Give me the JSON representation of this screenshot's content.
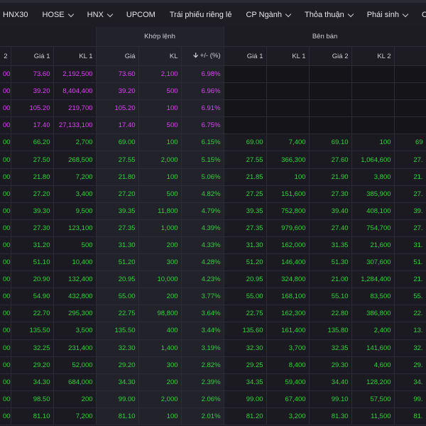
{
  "nav": {
    "tabs": [
      {
        "label": "HNX30",
        "dropdown": false
      },
      {
        "label": "HOSE",
        "dropdown": true
      },
      {
        "label": "HNX",
        "dropdown": true
      },
      {
        "label": "UPCOM",
        "dropdown": false
      },
      {
        "label": "Trái phiếu riêng lẻ",
        "dropdown": false
      },
      {
        "label": "CP Ngành",
        "dropdown": true
      },
      {
        "label": "Thỏa thuận",
        "dropdown": true
      },
      {
        "label": "Phái sinh",
        "dropdown": true
      },
      {
        "label": "Chứng quy",
        "dropdown": false
      }
    ]
  },
  "table": {
    "group_khop": "Khớp lệnh",
    "group_ban": "Bên bán",
    "headers": [
      "2",
      "Giá 1",
      "KL 1",
      "Giá",
      "KL",
      "+/- (%)",
      "Giá 1",
      "KL 1",
      "Giá 2",
      "KL 2",
      ""
    ],
    "change_arrow": "🡫",
    "colors": {
      "ceiling": "#e040fb",
      "up": "#2fd43a"
    },
    "rows": [
      {
        "s": "ce",
        "c": [
          "00",
          "73.60",
          "2,192,500",
          "73.60",
          "2,100",
          "6.98%",
          "",
          "",
          "",
          "",
          ""
        ]
      },
      {
        "s": "ce",
        "c": [
          "00",
          "39.20",
          "8,404,400",
          "39.20",
          "500",
          "6.96%",
          "",
          "",
          "",
          "",
          ""
        ]
      },
      {
        "s": "ce",
        "c": [
          "00",
          "105.20",
          "219,700",
          "105.20",
          "100",
          "6.91%",
          "",
          "",
          "",
          "",
          ""
        ]
      },
      {
        "s": "ce",
        "c": [
          "00",
          "17.40",
          "27,133,100",
          "17.40",
          "500",
          "6.75%",
          "",
          "",
          "",
          "",
          ""
        ]
      },
      {
        "s": "up",
        "c": [
          "00",
          "66.20",
          "2,700",
          "69.00",
          "100",
          "6.15%",
          "69.00",
          "7,400",
          "69.10",
          "100",
          "69"
        ]
      },
      {
        "s": "up",
        "c": [
          "00",
          "27.50",
          "268,500",
          "27.55",
          "2,000",
          "5.15%",
          "27.55",
          "366,300",
          "27.60",
          "1,064,600",
          "27."
        ]
      },
      {
        "s": "up",
        "c": [
          "00",
          "21.80",
          "7,200",
          "21.80",
          "100",
          "5.06%",
          "21.85",
          "100",
          "21.90",
          "3,800",
          "21."
        ]
      },
      {
        "s": "up",
        "c": [
          "00",
          "27.20",
          "3,400",
          "27.20",
          "500",
          "4.82%",
          "27.25",
          "151,600",
          "27.30",
          "385,900",
          "27."
        ]
      },
      {
        "s": "up",
        "c": [
          "00",
          "39.30",
          "9,500",
          "39.35",
          "11,800",
          "4.79%",
          "39.35",
          "752,800",
          "39.40",
          "408,100",
          "39."
        ]
      },
      {
        "s": "up",
        "c": [
          "00",
          "27.30",
          "123,100",
          "27.35",
          "1,000",
          "4.39%",
          "27.35",
          "979,600",
          "27.40",
          "754,700",
          "27."
        ]
      },
      {
        "s": "up",
        "c": [
          "00",
          "31.20",
          "500",
          "31.30",
          "200",
          "4.33%",
          "31.30",
          "162,000",
          "31.35",
          "21,600",
          "31."
        ]
      },
      {
        "s": "up",
        "c": [
          "00",
          "51.10",
          "10,400",
          "51.20",
          "300",
          "4.28%",
          "51.20",
          "146,400",
          "51.30",
          "307,600",
          "51."
        ]
      },
      {
        "s": "up",
        "c": [
          "00",
          "20.90",
          "132,400",
          "20.95",
          "10,000",
          "4.23%",
          "20.95",
          "324,800",
          "21.00",
          "1,284,400",
          "21."
        ]
      },
      {
        "s": "up",
        "c": [
          "00",
          "54.90",
          "432,800",
          "55.00",
          "200",
          "3.77%",
          "55.00",
          "168,100",
          "55.10",
          "83,500",
          "55."
        ]
      },
      {
        "s": "up",
        "c": [
          "00",
          "22.70",
          "295,300",
          "22.75",
          "98,800",
          "3.64%",
          "22.75",
          "162,300",
          "22.80",
          "386,800",
          "22."
        ]
      },
      {
        "s": "up",
        "c": [
          "00",
          "135.50",
          "3,500",
          "135.50",
          "400",
          "3.44%",
          "135.60",
          "161,400",
          "135.80",
          "2,400",
          "13."
        ]
      },
      {
        "s": "up",
        "c": [
          "00",
          "32.25",
          "231,400",
          "32.30",
          "1,400",
          "3.19%",
          "32.30",
          "3,700",
          "32.35",
          "141,600",
          "32."
        ]
      },
      {
        "s": "up",
        "c": [
          "00",
          "29.20",
          "52,000",
          "29.20",
          "300",
          "2.82%",
          "29.25",
          "8,400",
          "29.30",
          "4,600",
          "29."
        ]
      },
      {
        "s": "up",
        "c": [
          "00",
          "34.30",
          "684,000",
          "34.30",
          "200",
          "2.39%",
          "34.35",
          "59,400",
          "34.40",
          "128,200",
          "34."
        ]
      },
      {
        "s": "up",
        "c": [
          "00",
          "98.50",
          "200",
          "99.00",
          "2,000",
          "2.06%",
          "99.00",
          "67,400",
          "99.10",
          "57,500",
          "99."
        ]
      },
      {
        "s": "up",
        "c": [
          "00",
          "81.10",
          "7,200",
          "81.10",
          "100",
          "2.01%",
          "81.20",
          "3,200",
          "81.30",
          "11,500",
          "81."
        ]
      }
    ]
  }
}
